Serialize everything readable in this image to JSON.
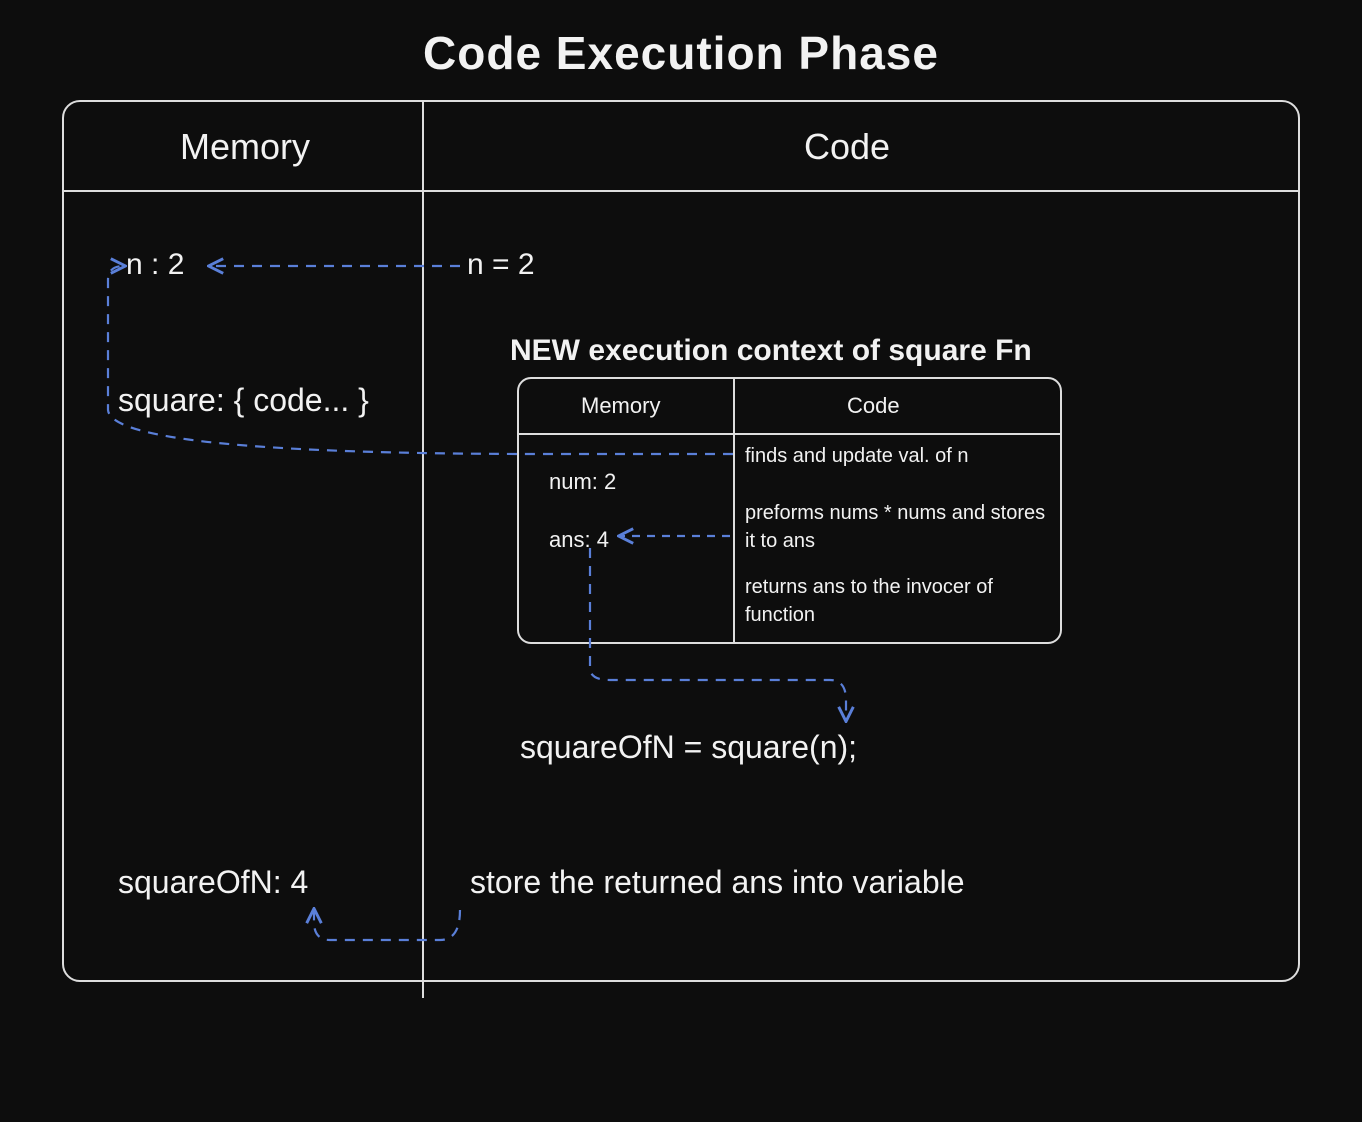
{
  "title": "Code Execution Phase",
  "outer": {
    "headers": {
      "memory": "Memory",
      "code": "Code"
    },
    "memory": {
      "n": "n : 2",
      "square": "square: { code... }",
      "squareOfN": "squareOfN: 4"
    },
    "code": {
      "n_assign": "n = 2",
      "new_context_header": "NEW execution context of square Fn",
      "squareOfN_call": "squareOfN = square(n);",
      "store_note": "store the returned ans into variable"
    }
  },
  "inner": {
    "headers": {
      "memory": "Memory",
      "code": "Code"
    },
    "memory": {
      "num": "num: 2",
      "ans": "ans: 4"
    },
    "code": {
      "step1": "finds and update val. of n",
      "step2": "preforms nums * nums and stores it to ans",
      "step3": "returns ans to the invocer of  function"
    }
  },
  "colors": {
    "arrow": "#5a7fd8",
    "bg": "#0d0d0d",
    "fg": "#f2f2f2"
  }
}
